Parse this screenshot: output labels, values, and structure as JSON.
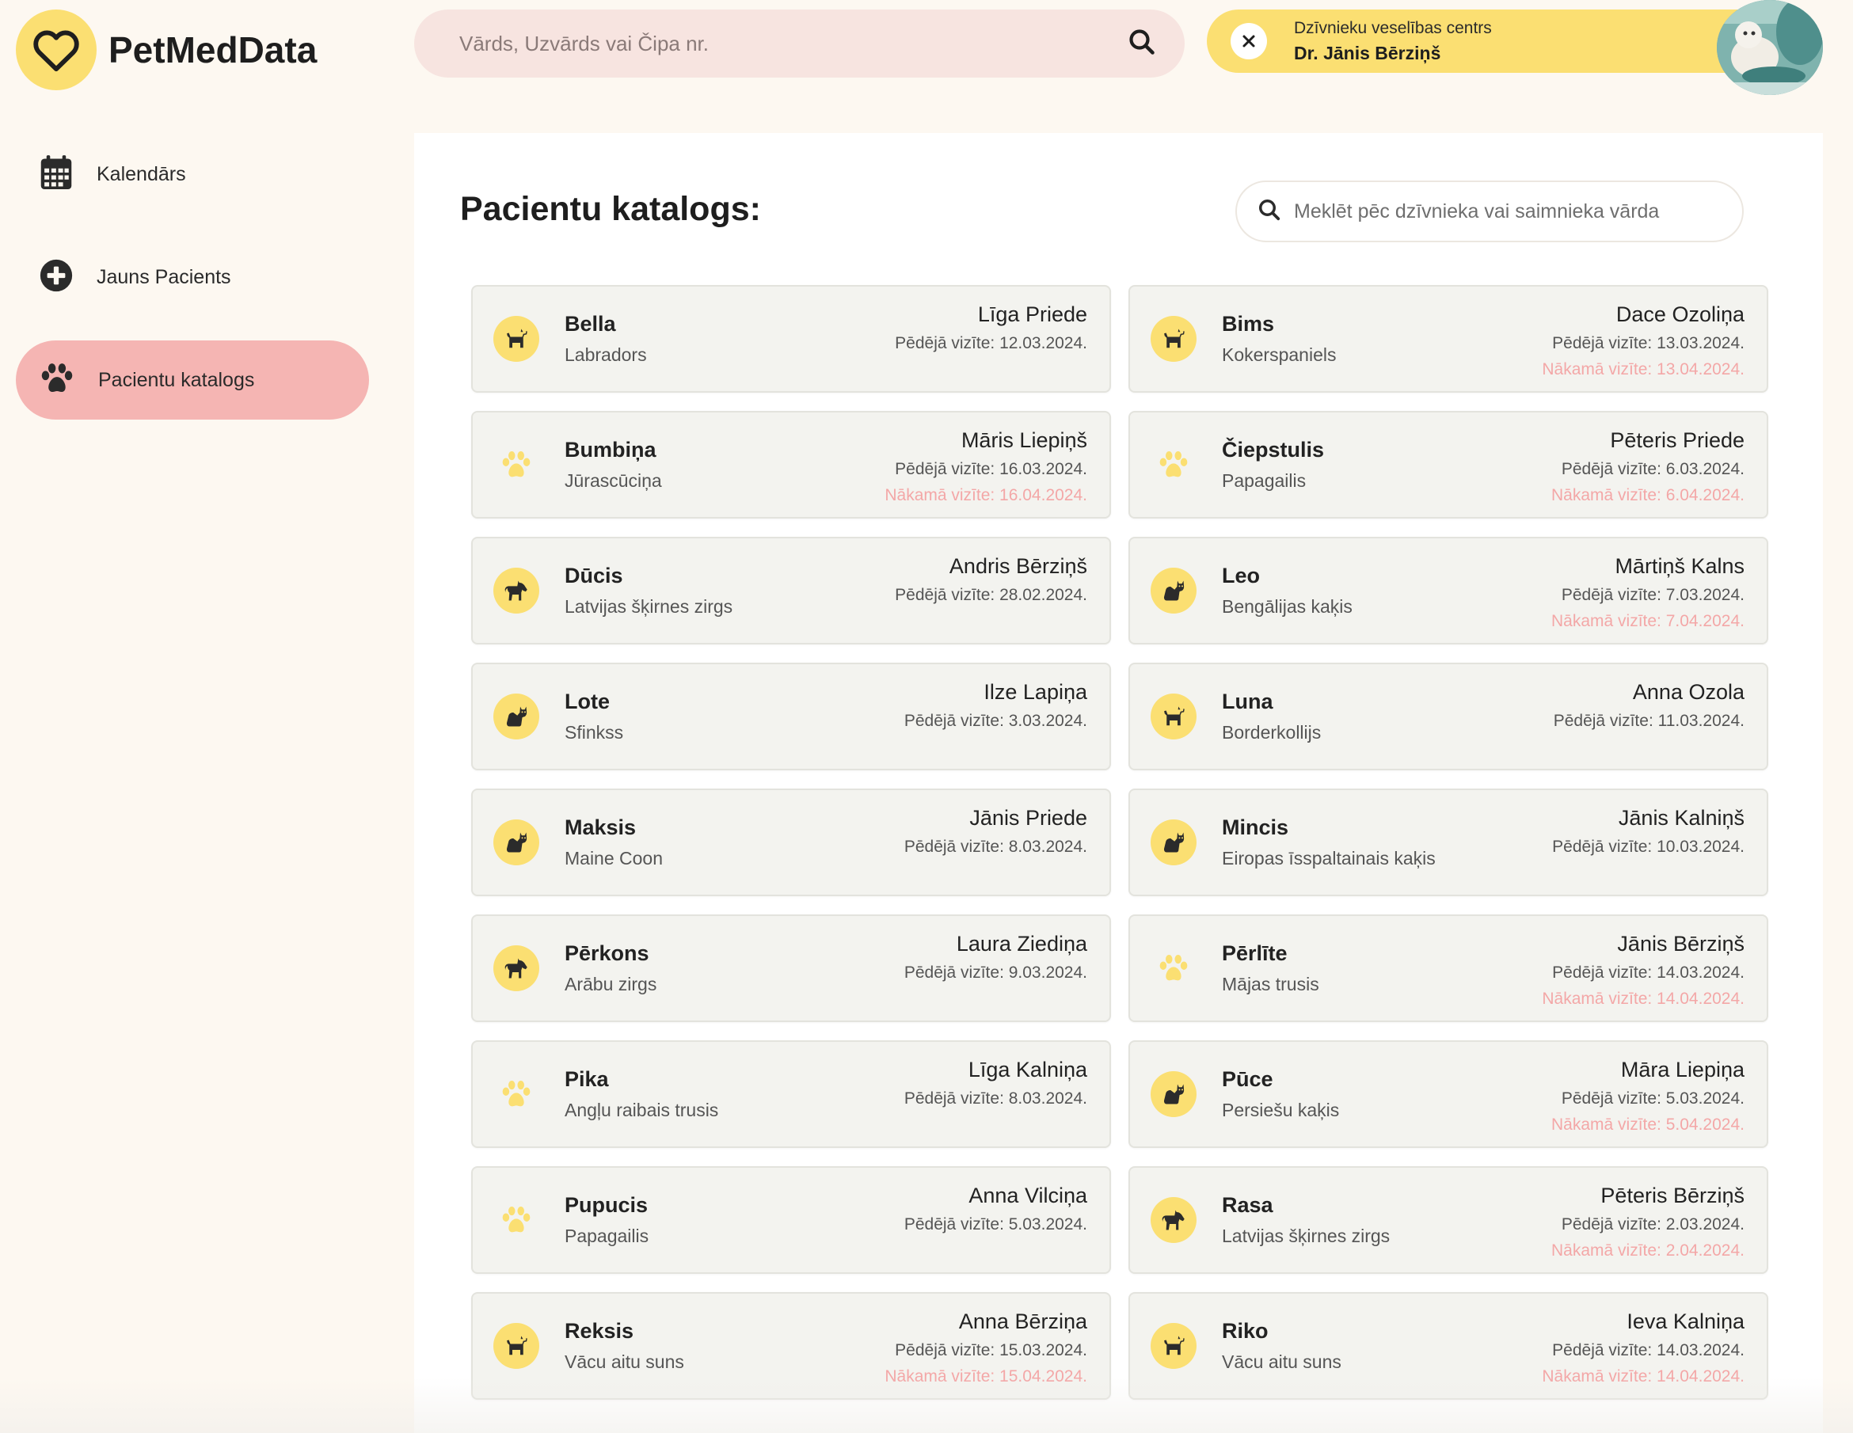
{
  "app": {
    "name": "PetMedData"
  },
  "top_search": {
    "placeholder": "Vārds, Uzvārds vai Čipa nr."
  },
  "clinic": {
    "name": "Dzīvnieku veselības centrs",
    "doctor": "Dr. Jānis Bērziņš"
  },
  "sidebar": {
    "items": [
      {
        "label": "Kalendārs",
        "icon": "calendar-icon",
        "active": false
      },
      {
        "label": "Jauns Pacients",
        "icon": "plus-circle-icon",
        "active": false
      },
      {
        "label": "Pacientu katalogs",
        "icon": "paw-icon",
        "active": true
      }
    ]
  },
  "catalog": {
    "title": "Pacientu katalogs:",
    "search_placeholder": "Meklēt pēc dzīvnieka vai saimnieka vārda",
    "patients": [
      {
        "name": "Bella",
        "breed": "Labradors",
        "owner": "Līga Priede",
        "last_visit": "Pēdējā vizīte: 12.03.2024.",
        "next_visit": "",
        "icon": "dog-icon"
      },
      {
        "name": "Bims",
        "breed": "Kokerspaniels",
        "owner": "Dace Ozoliņa",
        "last_visit": "Pēdējā vizīte: 13.03.2024.",
        "next_visit": "Nākamā vizīte: 13.04.2024.",
        "icon": "dog-icon"
      },
      {
        "name": "Bumbiņa",
        "breed": "Jūrascūciņa",
        "owner": "Māris Liepiņš",
        "last_visit": "Pēdējā vizīte: 16.03.2024.",
        "next_visit": "Nākamā vizīte: 16.04.2024.",
        "icon": "paw-icon"
      },
      {
        "name": "Čiepstulis",
        "breed": "Papagailis",
        "owner": "Pēteris Priede",
        "last_visit": "Pēdējā vizīte: 6.03.2024.",
        "next_visit": "Nākamā vizīte: 6.04.2024.",
        "icon": "paw-icon"
      },
      {
        "name": "Dūcis",
        "breed": "Latvijas šķirnes zirgs",
        "owner": "Andris Bērziņš",
        "last_visit": "Pēdējā vizīte: 28.02.2024.",
        "next_visit": "",
        "icon": "horse-icon"
      },
      {
        "name": "Leo",
        "breed": "Bengālijas kaķis",
        "owner": "Mārtiņš Kalns",
        "last_visit": "Pēdējā vizīte: 7.03.2024.",
        "next_visit": "Nākamā vizīte: 7.04.2024.",
        "icon": "cat-icon"
      },
      {
        "name": "Lote",
        "breed": "Sfinkss",
        "owner": "Ilze Lapiņa",
        "last_visit": "Pēdējā vizīte: 3.03.2024.",
        "next_visit": "",
        "icon": "cat-icon"
      },
      {
        "name": "Luna",
        "breed": "Borderkollijs",
        "owner": "Anna Ozola",
        "last_visit": "Pēdējā vizīte: 11.03.2024.",
        "next_visit": "",
        "icon": "dog-icon"
      },
      {
        "name": "Maksis",
        "breed": "Maine Coon",
        "owner": "Jānis Priede",
        "last_visit": "Pēdējā vizīte: 8.03.2024.",
        "next_visit": "",
        "icon": "cat-icon"
      },
      {
        "name": "Mincis",
        "breed": "Eiropas īsspaltainais kaķis",
        "owner": "Jānis Kalniņš",
        "last_visit": "Pēdējā vizīte: 10.03.2024.",
        "next_visit": "",
        "icon": "cat-icon"
      },
      {
        "name": "Pērkons",
        "breed": "Arābu zirgs",
        "owner": "Laura Ziediņa",
        "last_visit": "Pēdējā vizīte: 9.03.2024.",
        "next_visit": "",
        "icon": "horse-icon"
      },
      {
        "name": "Pērlīte",
        "breed": "Mājas trusis",
        "owner": "Jānis Bērziņš",
        "last_visit": "Pēdējā vizīte: 14.03.2024.",
        "next_visit": "Nākamā vizīte: 14.04.2024.",
        "icon": "paw-icon"
      },
      {
        "name": "Pika",
        "breed": "Angļu raibais trusis",
        "owner": "Līga Kalniņa",
        "last_visit": "Pēdējā vizīte: 8.03.2024.",
        "next_visit": "",
        "icon": "paw-icon"
      },
      {
        "name": "Pūce",
        "breed": "Persiešu kaķis",
        "owner": "Māra Liepiņa",
        "last_visit": "Pēdējā vizīte: 5.03.2024.",
        "next_visit": "Nākamā vizīte: 5.04.2024.",
        "icon": "cat-icon"
      },
      {
        "name": "Pupucis",
        "breed": "Papagailis",
        "owner": "Anna Vilciņa",
        "last_visit": "Pēdējā vizīte: 5.03.2024.",
        "next_visit": "",
        "icon": "paw-icon"
      },
      {
        "name": "Rasa",
        "breed": "Latvijas šķirnes zirgs",
        "owner": "Pēteris Bērziņš",
        "last_visit": "Pēdējā vizīte: 2.03.2024.",
        "next_visit": "Nākamā vizīte: 2.04.2024.",
        "icon": "horse-icon"
      },
      {
        "name": "Reksis",
        "breed": "Vācu aitu suns",
        "owner": "Anna Bērziņa",
        "last_visit": "Pēdējā vizīte: 15.03.2024.",
        "next_visit": "Nākamā vizīte: 15.04.2024.",
        "icon": "dog-icon"
      },
      {
        "name": "Riko",
        "breed": "Vācu aitu suns",
        "owner": "Ieva Kalniņa",
        "last_visit": "Pēdējā vizīte: 14.03.2024.",
        "next_visit": "Nākamā vizīte: 14.04.2024.",
        "icon": "dog-icon"
      }
    ]
  },
  "colors": {
    "accent_yellow": "#fbdf72",
    "active_nav_pink": "#f5b5b3",
    "next_visit_pink": "#f3a7a7",
    "background": "#fdf8f1"
  }
}
